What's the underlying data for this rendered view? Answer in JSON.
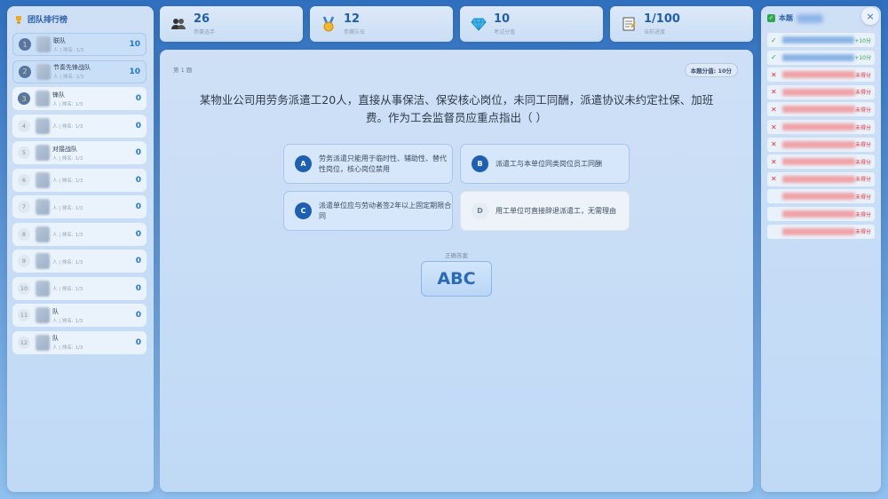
{
  "leaderboard": {
    "title": "团队排行榜",
    "teams": [
      {
        "rank": "1",
        "name": "联队",
        "sub": "人 | 排名: 1/3",
        "score": "10"
      },
      {
        "rank": "2",
        "name": "节奏先锋战队",
        "sub": "人 | 排名: 2/3",
        "score": "10"
      },
      {
        "rank": "3",
        "name": "锋队",
        "sub": "人 | 排名: 1/3",
        "score": "0"
      },
      {
        "rank": "4",
        "name": "",
        "sub": "人 | 排名: 1/3",
        "score": "0"
      },
      {
        "rank": "5",
        "name": "对接战队",
        "sub": "人 | 排名: 1/3",
        "score": "0"
      },
      {
        "rank": "6",
        "name": "",
        "sub": "人 | 排名: 1/3",
        "score": "0"
      },
      {
        "rank": "7",
        "name": "",
        "sub": "人 | 排名: 1/3",
        "score": "0"
      },
      {
        "rank": "8",
        "name": "",
        "sub": "人 | 排名: 1/3",
        "score": "0"
      },
      {
        "rank": "9",
        "name": "",
        "sub": "人 | 排名: 1/3",
        "score": "0"
      },
      {
        "rank": "10",
        "name": "",
        "sub": "人 | 排名: 1/3",
        "score": "0"
      },
      {
        "rank": "11",
        "name": "队",
        "sub": "人 | 排名: 1/3",
        "score": "0"
      },
      {
        "rank": "12",
        "name": "队",
        "sub": "人 | 排名: 1/3",
        "score": "0"
      }
    ]
  },
  "stats": [
    {
      "icon": "people-icon",
      "value": "26",
      "label": "参赛选手"
    },
    {
      "icon": "medal-icon",
      "value": "12",
      "label": "参赛队伍"
    },
    {
      "icon": "diamond-icon",
      "value": "10",
      "label": "考试分值"
    },
    {
      "icon": "notepad-icon",
      "value": "1/100",
      "label": "当前进度"
    }
  ],
  "question": {
    "number": "第 1 题",
    "points": "本题分值: 10分",
    "text": "某物业公司用劳务派遣工20人，直接从事保洁、保安核心岗位，未同工同酬，派遣协议未约定社保、加班费。作为工会监督员应重点指出（ ）",
    "options": [
      {
        "letter": "A",
        "text": "劳务派遣只能用于临时性、辅助性、替代性岗位，核心岗位禁用",
        "selected": true
      },
      {
        "letter": "B",
        "text": "派遣工与本单位同类岗位员工同酬",
        "selected": true
      },
      {
        "letter": "C",
        "text": "派遣单位应与劳动者签2年以上固定期限合同",
        "selected": true
      },
      {
        "letter": "D",
        "text": "用工单位可直接辞退派遣工，无需理由",
        "selected": false
      }
    ],
    "answer_label": "正确答案",
    "answer": "ABC"
  },
  "records": {
    "title": "本题",
    "close": "×",
    "items": [
      {
        "mark": "✓",
        "ok": true,
        "result": "+10分"
      },
      {
        "mark": "✓",
        "ok": true,
        "result": "+10分"
      },
      {
        "mark": "✕",
        "ok": false,
        "result": "未得分"
      },
      {
        "mark": "✕",
        "ok": false,
        "result": "未得分"
      },
      {
        "mark": "✕",
        "ok": false,
        "result": "未得分"
      },
      {
        "mark": "✕",
        "ok": false,
        "result": "未得分"
      },
      {
        "mark": "✕",
        "ok": false,
        "result": "未得分"
      },
      {
        "mark": "✕",
        "ok": false,
        "result": "未得分"
      },
      {
        "mark": "✕",
        "ok": false,
        "result": "未得分"
      },
      {
        "mark": "",
        "ok": false,
        "result": "未得分"
      },
      {
        "mark": "",
        "ok": false,
        "result": "未得分"
      },
      {
        "mark": "",
        "ok": false,
        "result": "未得分"
      }
    ]
  },
  "colors": {
    "correct": "#2ea84a",
    "wrong": "#e0333b",
    "accent": "#1f76d6"
  }
}
